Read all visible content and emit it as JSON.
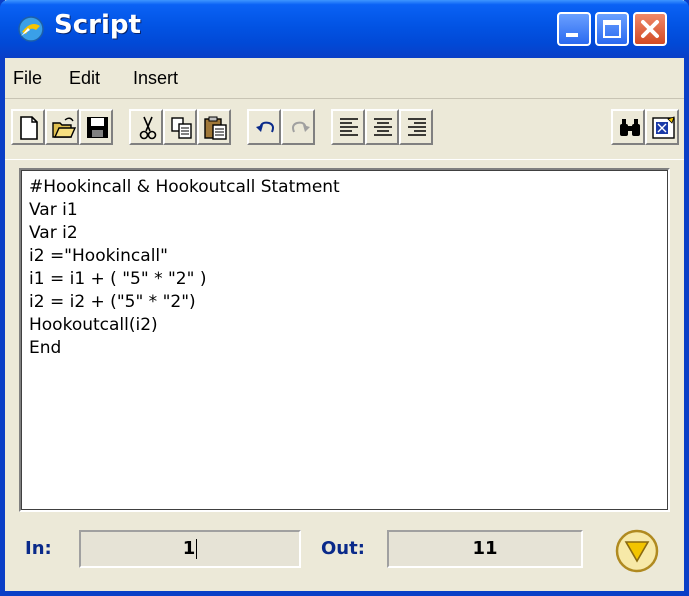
{
  "window": {
    "title": "Script"
  },
  "icons": {
    "app": "script-app-icon",
    "minimize": "minimize-icon",
    "maximize": "maximize-icon",
    "close": "close-icon"
  },
  "menu": {
    "items": [
      "File",
      "Edit",
      "Insert"
    ]
  },
  "toolbar": {
    "buttons": [
      "new-document",
      "open-folder",
      "save-disk",
      "cut-scissors",
      "copy",
      "paste",
      "undo",
      "redo",
      "align-left",
      "align-center",
      "align-right",
      "find-binoculars",
      "script-wizard"
    ]
  },
  "editor": {
    "lines": [
      "#Hookincall & Hookoutcall Statment",
      "Var i1",
      "Var i2",
      "i2 =\"Hookincall\"",
      "i1 = i1 + ( \"5\" * \"2\" )",
      "i2 = i2 + (\"5\" * \"2\")",
      "Hookoutcall(i2)",
      "End"
    ]
  },
  "status": {
    "in_label": "In:",
    "in_value": "1",
    "out_label": "Out:",
    "out_value": "11"
  },
  "colors": {
    "titlebar": "#0355e6",
    "face": "#ece9d8",
    "label_blue": "#0a2a8a",
    "go_button": "#f2c400"
  }
}
